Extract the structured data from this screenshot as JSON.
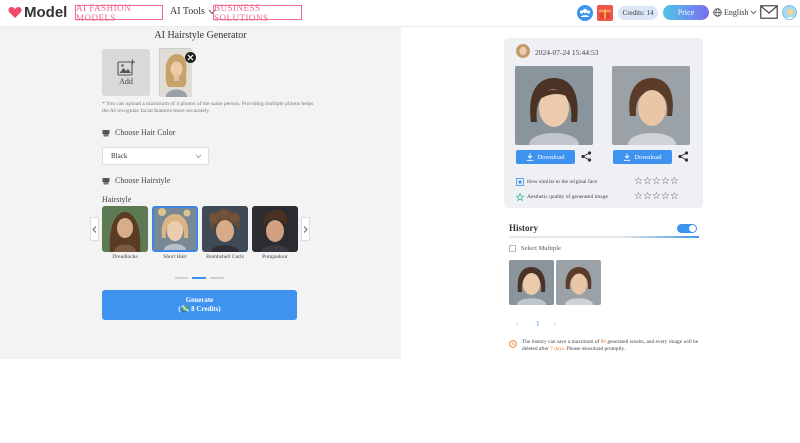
{
  "header": {
    "logo_text": "Model",
    "nav_ai_fashion": "AI FASHION MODELS",
    "nav_ai_tools": "AI Tools",
    "nav_business": "BUSINESS SOLUTIONS",
    "credits_label": "Credits: 14",
    "price_label": "Price",
    "language": "English"
  },
  "generator": {
    "title": "AI Hairstyle Generator",
    "add_label": "Add",
    "hint": "* You can upload a maximum of 4 photos of the same person. Providing multiple photos helps the AI recognize facial features more accurately.",
    "hair_color_label": "Choose Hair Color",
    "hair_color_value": "Black",
    "hairstyle_section_label": "Choose Hairstyle",
    "hairstyle_label": "Hairstyle",
    "hairstyles": [
      {
        "name": "Dreadlocks",
        "selected": false
      },
      {
        "name": "Short Hair",
        "selected": true
      },
      {
        "name": "Bombshell Curls",
        "selected": false
      },
      {
        "name": "Pompadour",
        "selected": false
      }
    ],
    "generate_label": "Generate",
    "generate_cost": "(💸 8 Credits)"
  },
  "result": {
    "timestamp": "2024-07-24 15:44:53",
    "download_label": "Download",
    "similarity_label": "How similar to the original face",
    "quality_label": "Aesthetic quality of generated image",
    "stars": "☆☆☆☆☆"
  },
  "history": {
    "title": "History",
    "select_multiple": "Select Multiple",
    "page_prev": "‹",
    "page_current": "1",
    "page_next": "›",
    "notice_part1": "The history can save a maximum of ",
    "notice_max": "80",
    "notice_part2": " generated results, and every image will be deleted after ",
    "notice_days": "7 days",
    "notice_part3": ". Please download promptly."
  },
  "colors": {
    "accent": "#3e93f0",
    "brand_pink": "#f06a8c",
    "panel_bg": "#f3f3f4"
  }
}
